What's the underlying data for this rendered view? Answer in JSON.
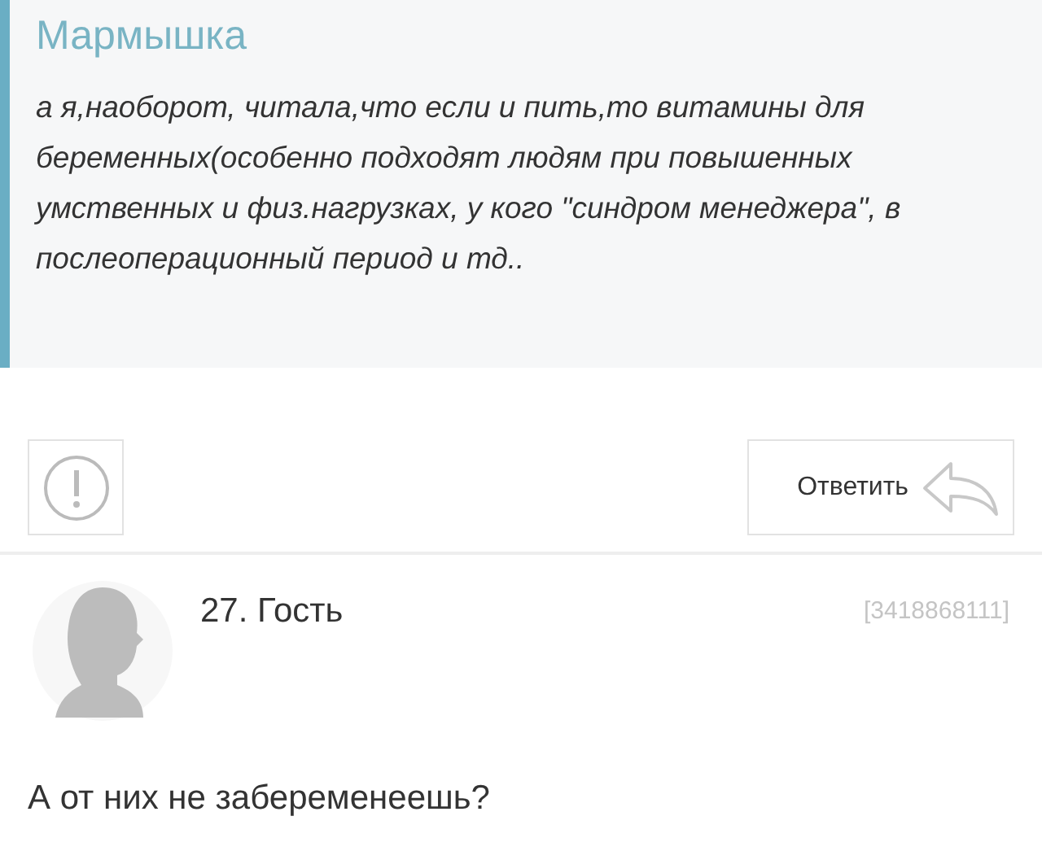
{
  "quote": {
    "author": "Мармышка",
    "text": "а я,наоборот, читала,что если и пить,то витамины для беременных(особенно подходят людям при повышенных умственных и физ.нагрузках, у кого \"синдром менеджера\", в послеоперационный период и тд.."
  },
  "actions": {
    "reply_label": "Ответить"
  },
  "comment": {
    "number_author": "27. Гость",
    "id": "[3418868111]",
    "text": "А от них не забеременеешь?"
  }
}
